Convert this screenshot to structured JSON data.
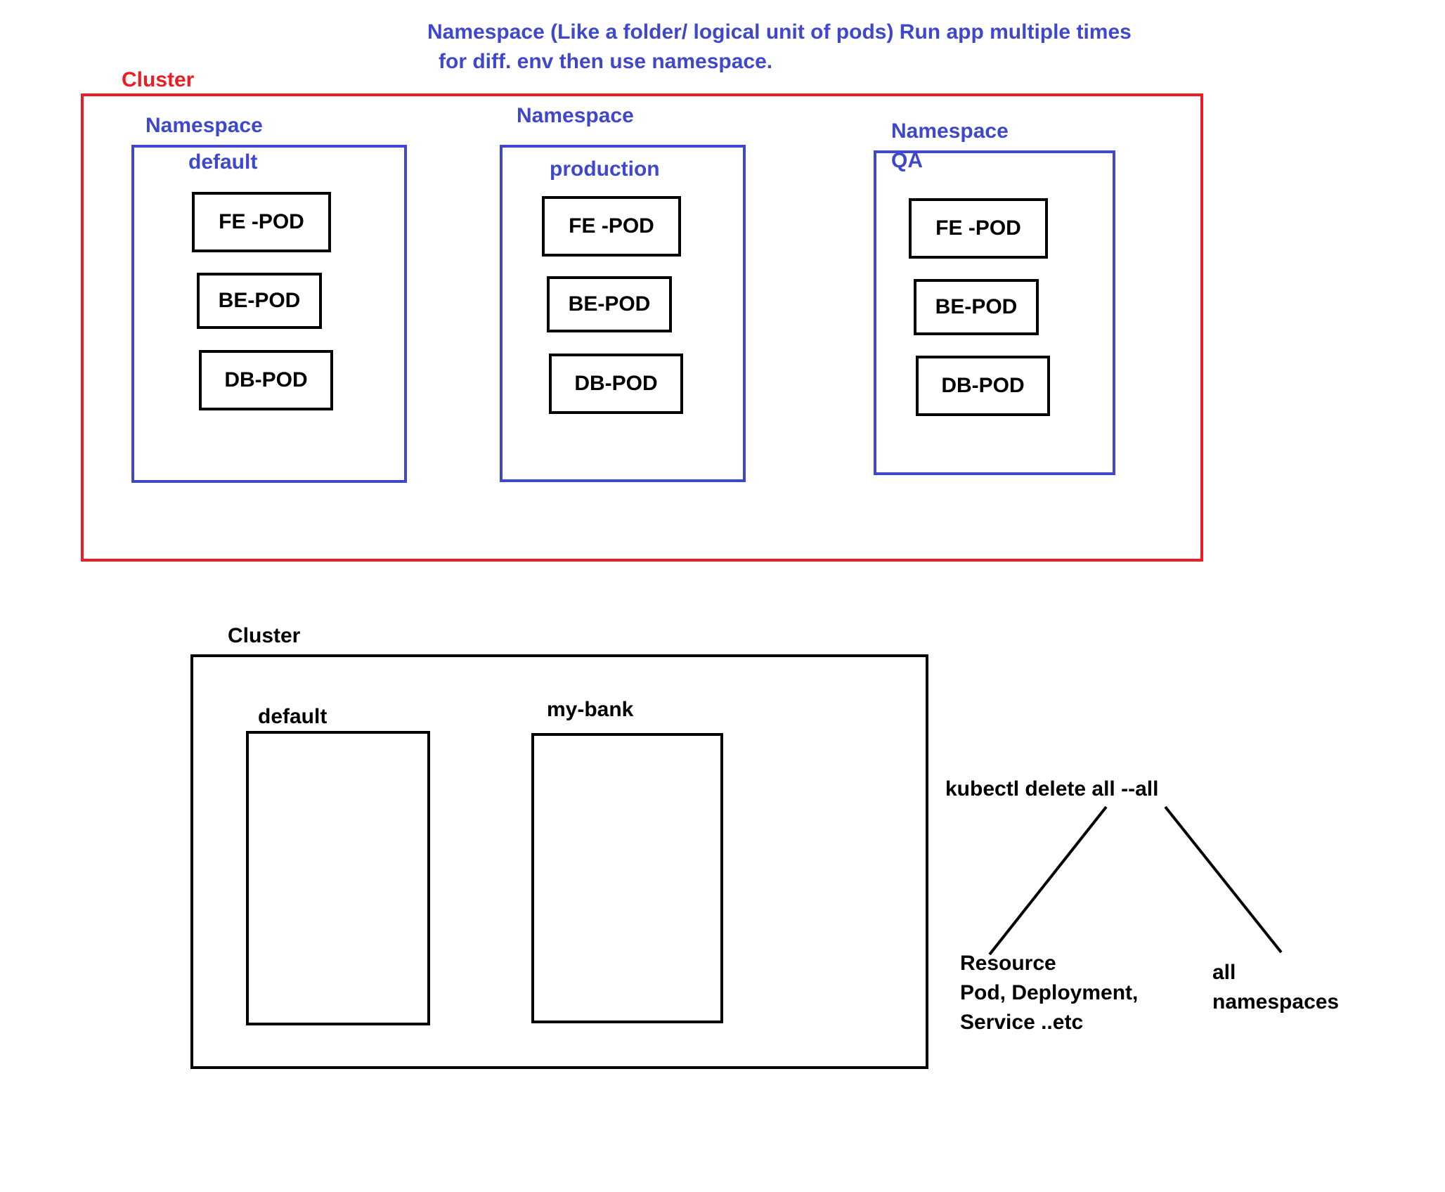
{
  "header": {
    "line1": "Namespace (Like a folder/ logical unit of pods) Run app multiple times",
    "line2": "for diff. env then use namespace."
  },
  "top_cluster": {
    "label": "Cluster",
    "namespaces": [
      {
        "title": "Namespace",
        "name": "default",
        "pods": [
          "FE -POD",
          "BE-POD",
          "DB-POD"
        ]
      },
      {
        "title": "Namespace",
        "name": "production",
        "pods": [
          "FE -POD",
          "BE-POD",
          "DB-POD"
        ]
      },
      {
        "title": "Namespace",
        "name": "QA",
        "pods": [
          "FE -POD",
          "BE-POD",
          "DB-POD"
        ]
      }
    ]
  },
  "bottom_cluster": {
    "label": "Cluster",
    "namespaces": [
      {
        "name": "default"
      },
      {
        "name": "my-bank"
      }
    ]
  },
  "command": {
    "text": "kubectl delete all --all",
    "left_branch": [
      "Resource",
      "Pod, Deployment,",
      "Service ..etc"
    ],
    "right_branch": [
      "all",
      "namespaces"
    ]
  },
  "colors": {
    "cluster_border": "#ed1c24",
    "namespace_border": "#3f48cc",
    "label_blue": "#3f48cc",
    "black": "#000000"
  }
}
